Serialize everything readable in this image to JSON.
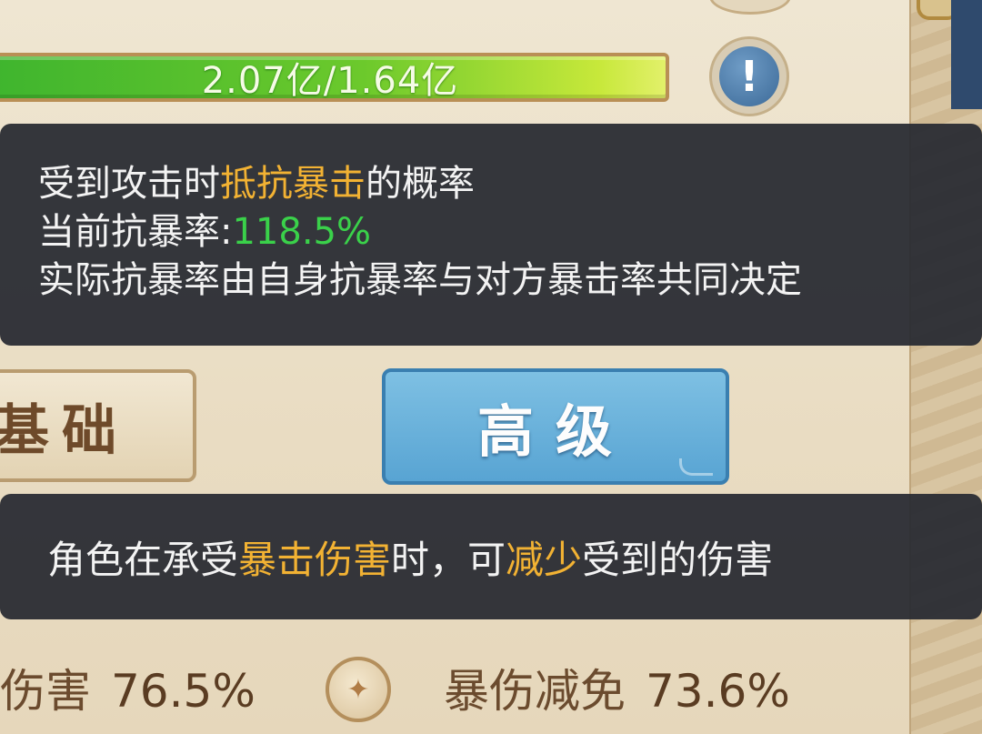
{
  "hp": {
    "text": "2.07亿/1.64亿"
  },
  "info_button": {
    "glyph": "!"
  },
  "tooltip_crit_resist": {
    "line1_prefix": "受到攻击时",
    "line1_highlight": "抵抗暴击",
    "line1_suffix": "的概率",
    "line2_label": "当前抗暴率:",
    "line2_value": "118.5%",
    "line3": "实际抗暴率由自身抗暴率与对方暴击率共同决定"
  },
  "background_ghost": {
    "adv_label": "高级"
  },
  "tabs": {
    "basic_label": "基础",
    "advanced_label": "高级",
    "active": "advanced"
  },
  "tooltip_crit_damage": {
    "part1": "角色在承受",
    "part2_highlight": "暴击伤害",
    "part3": "时，可",
    "part4_highlight": "减少",
    "part5": "受到的伤害"
  },
  "stats": {
    "left_label": "伤害",
    "left_value": "76.5%",
    "right_label": "暴伤减免",
    "right_value": "73.6%"
  },
  "colors": {
    "tooltip_bg": "#2a2c34",
    "highlight_gold": "#f2b233",
    "highlight_green": "#3ad14a",
    "tab_active": "#5aa6d4",
    "hp_bar": "#6cc92c"
  }
}
